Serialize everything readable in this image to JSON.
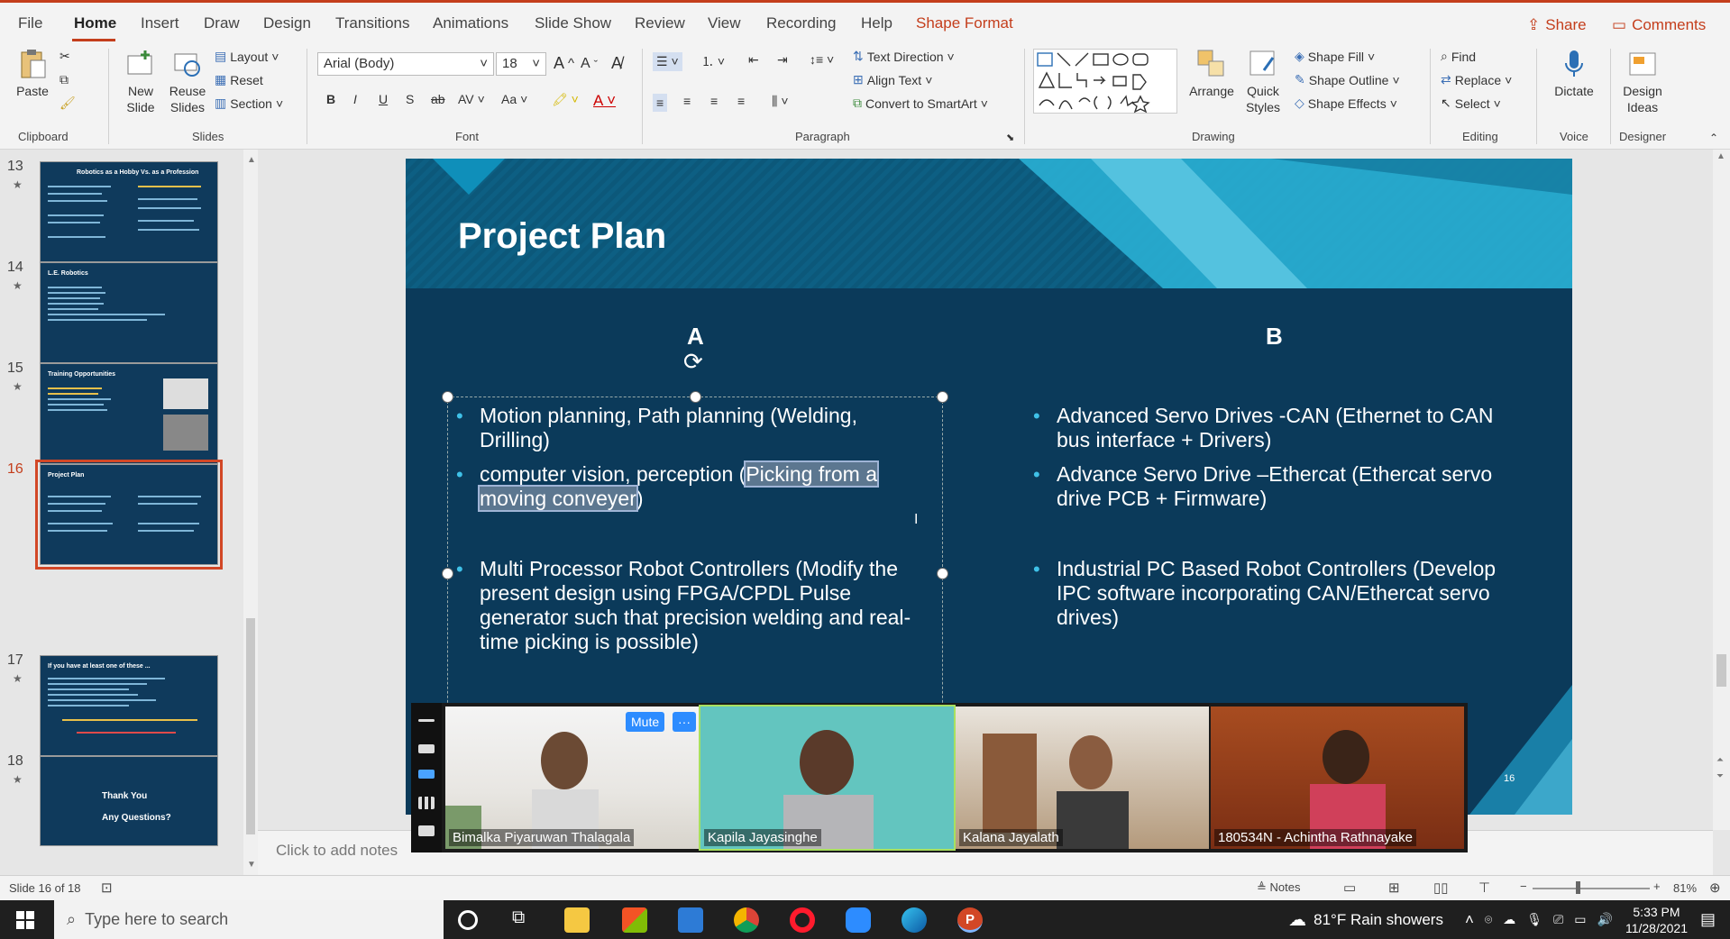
{
  "menubar": {
    "tabs": [
      "File",
      "Home",
      "Insert",
      "Draw",
      "Design",
      "Transitions",
      "Animations",
      "Slide Show",
      "Review",
      "View",
      "Recording",
      "Help",
      "Shape Format"
    ],
    "share_label": "Share",
    "comments_label": "Comments"
  },
  "ribbon": {
    "clipboard": {
      "paste": "Paste",
      "group": "Clipboard"
    },
    "slides": {
      "new_slide": "New Slide",
      "reuse": "Reuse Slides",
      "layout": "Layout",
      "reset": "Reset",
      "section": "Section",
      "group": "Slides"
    },
    "font": {
      "family": "Arial (Body)",
      "size": "18",
      "group": "Font",
      "b": "B",
      "i": "I",
      "u": "U",
      "s": "S",
      "abc": "ab",
      "av": "AV",
      "aa": "Aa",
      "grow": "A",
      "shrink": "A"
    },
    "paragraph": {
      "text_direction": "Text Direction",
      "align_text": "Align Text",
      "smartart": "Convert to SmartArt",
      "group": "Paragraph"
    },
    "drawing": {
      "arrange": "Arrange",
      "quick_styles": "Quick Styles",
      "shape_fill": "Shape Fill",
      "shape_outline": "Shape Outline",
      "shape_effects": "Shape Effects",
      "group": "Drawing"
    },
    "editing": {
      "find": "Find",
      "replace": "Replace",
      "select": "Select",
      "group": "Editing"
    },
    "voice": {
      "dictate": "Dictate",
      "group": "Voice"
    },
    "designer": {
      "ideas": "Design Ideas",
      "group": "Designer"
    }
  },
  "thumbnails": [
    {
      "num": "13",
      "title": "Robotics as a Hobby Vs. as a Profession"
    },
    {
      "num": "14",
      "title": "L.E. Robotics"
    },
    {
      "num": "15",
      "title": "Training Opportunities"
    },
    {
      "num": "16",
      "title": "Project Plan"
    },
    {
      "num": "17",
      "title": "If you have at least one of these ..."
    },
    {
      "num": "18",
      "title": "Thank You",
      "subtitle": "Any Questions?"
    }
  ],
  "slide": {
    "title": "Project Plan",
    "col_a": "A",
    "col_b": "B",
    "a_bullets": [
      "Motion planning, Path planning  (Welding, Drilling)",
      "computer vision, perception (",
      "Multi Processor Robot Controllers (Modify the present design using FPGA/CPDL Pulse generator such that precision welding and real-time picking is possible)"
    ],
    "a_highlight": "Picking from a moving conveyer",
    "a_close": ")",
    "b_bullets": [
      "Advanced Servo Drives -CAN (Ethernet to CAN bus interface + Drivers)",
      "Advance Servo Drive –Ethercat (Ethercat servo drive PCB + Firmware)",
      "Industrial PC Based Robot Controllers (Develop IPC software incorporating CAN/Ethercat servo drives)"
    ],
    "page_num": "16"
  },
  "notes_placeholder": "Click to add notes",
  "zoom": {
    "mute_label": "Mute",
    "more_label": "···",
    "participants": [
      "Bimalka Piyaruwan Thalagala",
      "Kapila Jayasinghe",
      "Kalana Jayalath",
      "180534N - Achintha Rathnayake"
    ]
  },
  "status": {
    "slide_info": "Slide 16 of 18",
    "notes_btn": "Notes",
    "zoom_level": "81%"
  },
  "taskbar": {
    "search_placeholder": "Type here to search",
    "weather": "81°F  Rain showers",
    "time": "5:33 PM",
    "date": "11/28/2021"
  }
}
